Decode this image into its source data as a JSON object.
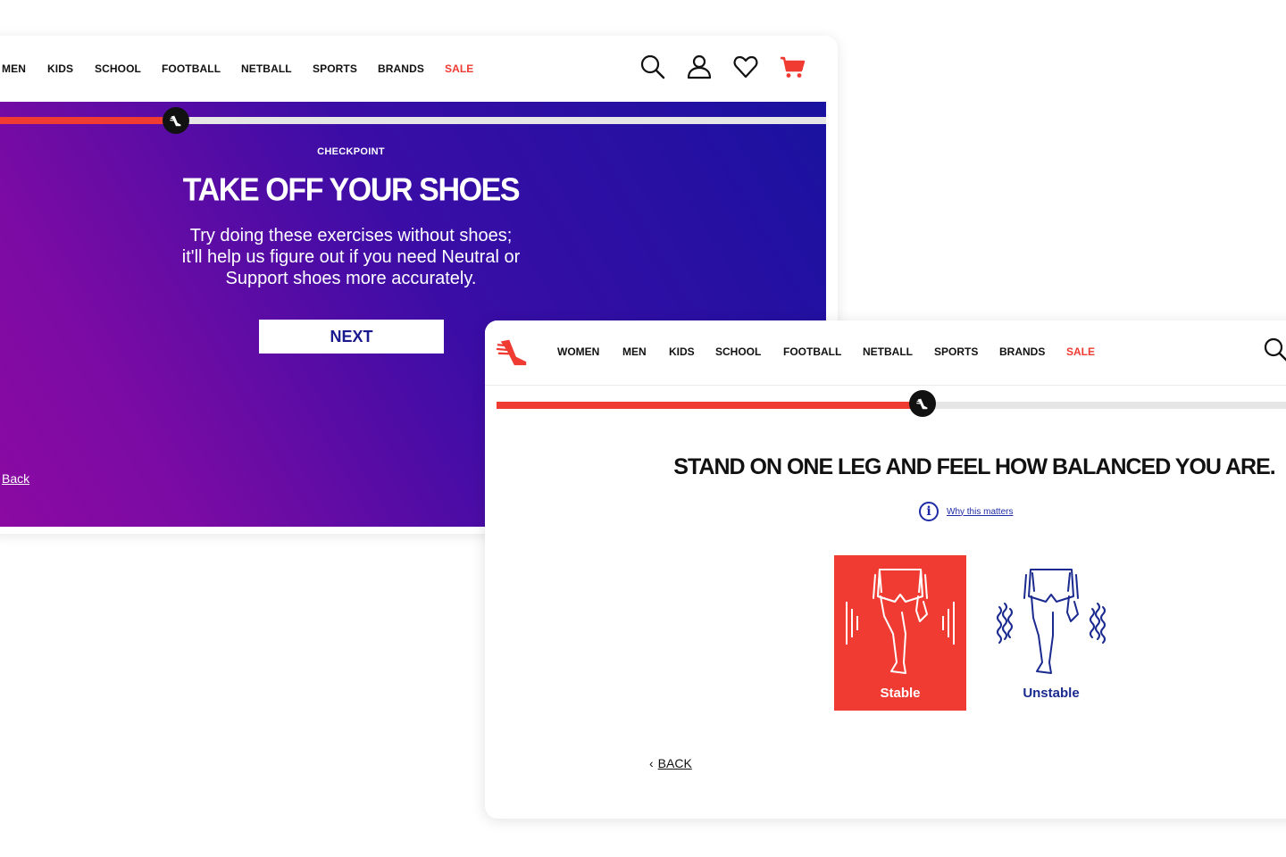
{
  "window_back": {
    "nav": {
      "items": [
        "MEN",
        "KIDS",
        "SCHOOL",
        "FOOTBALL",
        "NETBALL",
        "SPORTS",
        "BRANDS"
      ],
      "sale": "SALE",
      "icons": [
        "search-icon",
        "account-icon",
        "heart-icon",
        "cart-icon"
      ]
    },
    "progress": 0.23,
    "checkpoint": "CHECKPOINT",
    "title": "TAKE OFF YOUR SHOES",
    "text_lines": [
      "Try doing these exercises without shoes;",
      "it'll help us figure out if you need Neutral or",
      "Support shoes more accurately."
    ],
    "next_label": "NEXT",
    "back_label": "Back",
    "colors": {
      "gradient_start": "#8c0aa2",
      "gradient_end": "#1a12a0",
      "accent": "#ef3b32"
    }
  },
  "window_front": {
    "logo": "winged-foot-logo",
    "nav": {
      "items": [
        "WOMEN",
        "MEN",
        "KIDS",
        "SCHOOL",
        "FOOTBALL",
        "NETBALL",
        "SPORTS",
        "BRANDS"
      ],
      "sale": "SALE",
      "icons": [
        "search-icon"
      ]
    },
    "progress": 0.53,
    "question": "STAND ON ONE LEG AND FEEL HOW BALANCED YOU ARE.",
    "why_label": "Why this matters",
    "options": [
      {
        "label": "Stable",
        "selected": true
      },
      {
        "label": "Unstable",
        "selected": false
      }
    ],
    "back_label": "BACK",
    "colors": {
      "accent": "#ef3b32",
      "link": "#1f2aa6",
      "option_text": "#1a2a8f"
    }
  }
}
